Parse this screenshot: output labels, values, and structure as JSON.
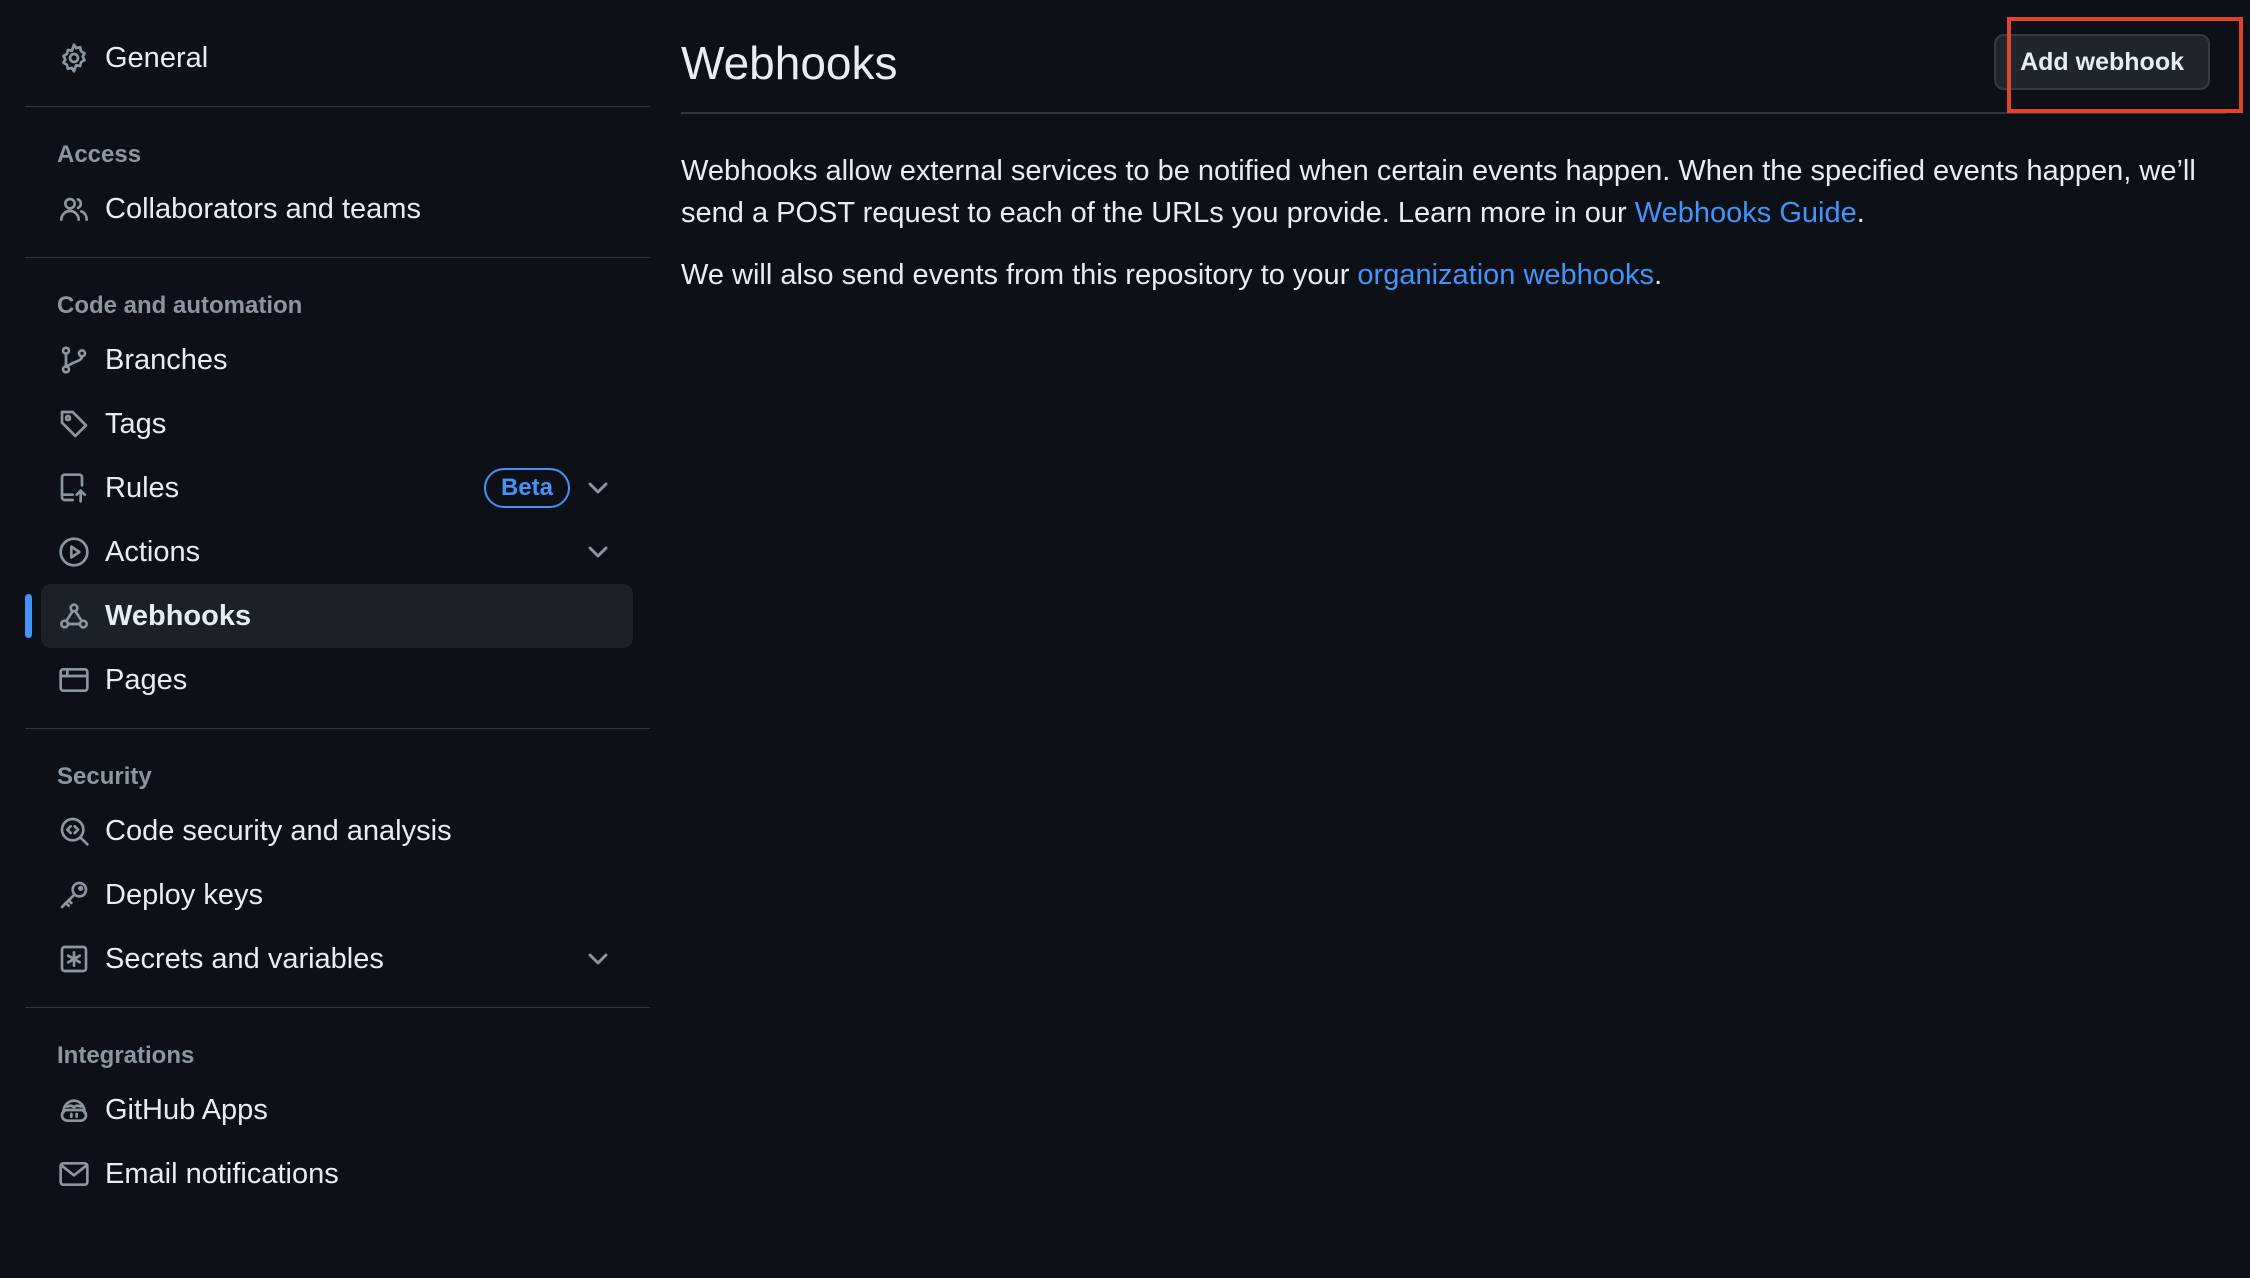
{
  "sidebar": {
    "general": "General",
    "access_header": "Access",
    "collaborators": "Collaborators and teams",
    "code_header": "Code and automation",
    "branches": "Branches",
    "tags": "Tags",
    "rules": "Rules",
    "rules_badge": "Beta",
    "actions": "Actions",
    "webhooks": "Webhooks",
    "pages": "Pages",
    "security_header": "Security",
    "code_security": "Code security and analysis",
    "deploy_keys": "Deploy keys",
    "secrets": "Secrets and variables",
    "integrations_header": "Integrations",
    "github_apps": "GitHub Apps",
    "email_notifications": "Email notifications"
  },
  "main": {
    "title": "Webhooks",
    "add_button": "Add webhook",
    "desc_part1": "Webhooks allow external services to be notified when certain events happen. When the specified events happen, we’ll send a POST request to each of the URLs you provide. Learn more in our ",
    "desc_link": "Webhooks Guide",
    "desc_end": ".",
    "org_part1": "We will also send events from this repository to your ",
    "org_link": "organization webhooks",
    "org_end": "."
  },
  "colors": {
    "background": "#0d1117",
    "accent": "#4493f8",
    "highlight_box": "#e0442d"
  }
}
